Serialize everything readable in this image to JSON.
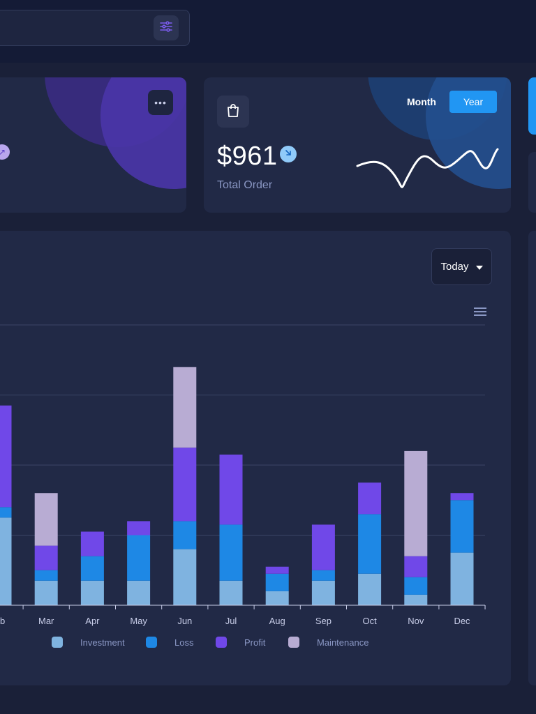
{
  "order_card": {
    "amount": "$961",
    "label": "Total Order",
    "toggle_month": "Month",
    "toggle_year": "Year",
    "active_toggle": "Year"
  },
  "chart_controls": {
    "period_select": "Today"
  },
  "colors": {
    "investment": "#7fb3e0",
    "loss": "#1e88e5",
    "profit": "#7048e8",
    "maintenance": "#b8acd3",
    "accent": "#2196f3"
  },
  "icons": [
    "filter-icon",
    "dots-icon",
    "shopping-bag-icon",
    "arrow-down-icon",
    "menu-icon",
    "chevron-down-icon"
  ],
  "chart_data": {
    "type": "bar",
    "stacked": true,
    "categories": [
      "Feb",
      "Mar",
      "Apr",
      "May",
      "Jun",
      "Jul",
      "Aug",
      "Sep",
      "Oct",
      "Nov",
      "Dec"
    ],
    "category_labels": [
      "eb",
      "Mar",
      "Apr",
      "May",
      "Jun",
      "Jul",
      "Aug",
      "Sep",
      "Oct",
      "Nov",
      "Dec"
    ],
    "series": [
      {
        "name": "Investment",
        "values": [
          50,
          14,
          14,
          14,
          32,
          14,
          8,
          14,
          18,
          6,
          30
        ]
      },
      {
        "name": "Loss",
        "values": [
          6,
          6,
          14,
          26,
          16,
          32,
          10,
          6,
          34,
          10,
          30
        ]
      },
      {
        "name": "Profit",
        "values": [
          58,
          14,
          14,
          8,
          42,
          40,
          4,
          26,
          18,
          12,
          4
        ]
      },
      {
        "name": "Maintenance",
        "values": [
          0,
          30,
          0,
          0,
          46,
          0,
          0,
          0,
          0,
          60,
          0
        ]
      }
    ],
    "ylim": [
      0,
      160
    ],
    "grid": true,
    "legend_position": "bottom"
  }
}
